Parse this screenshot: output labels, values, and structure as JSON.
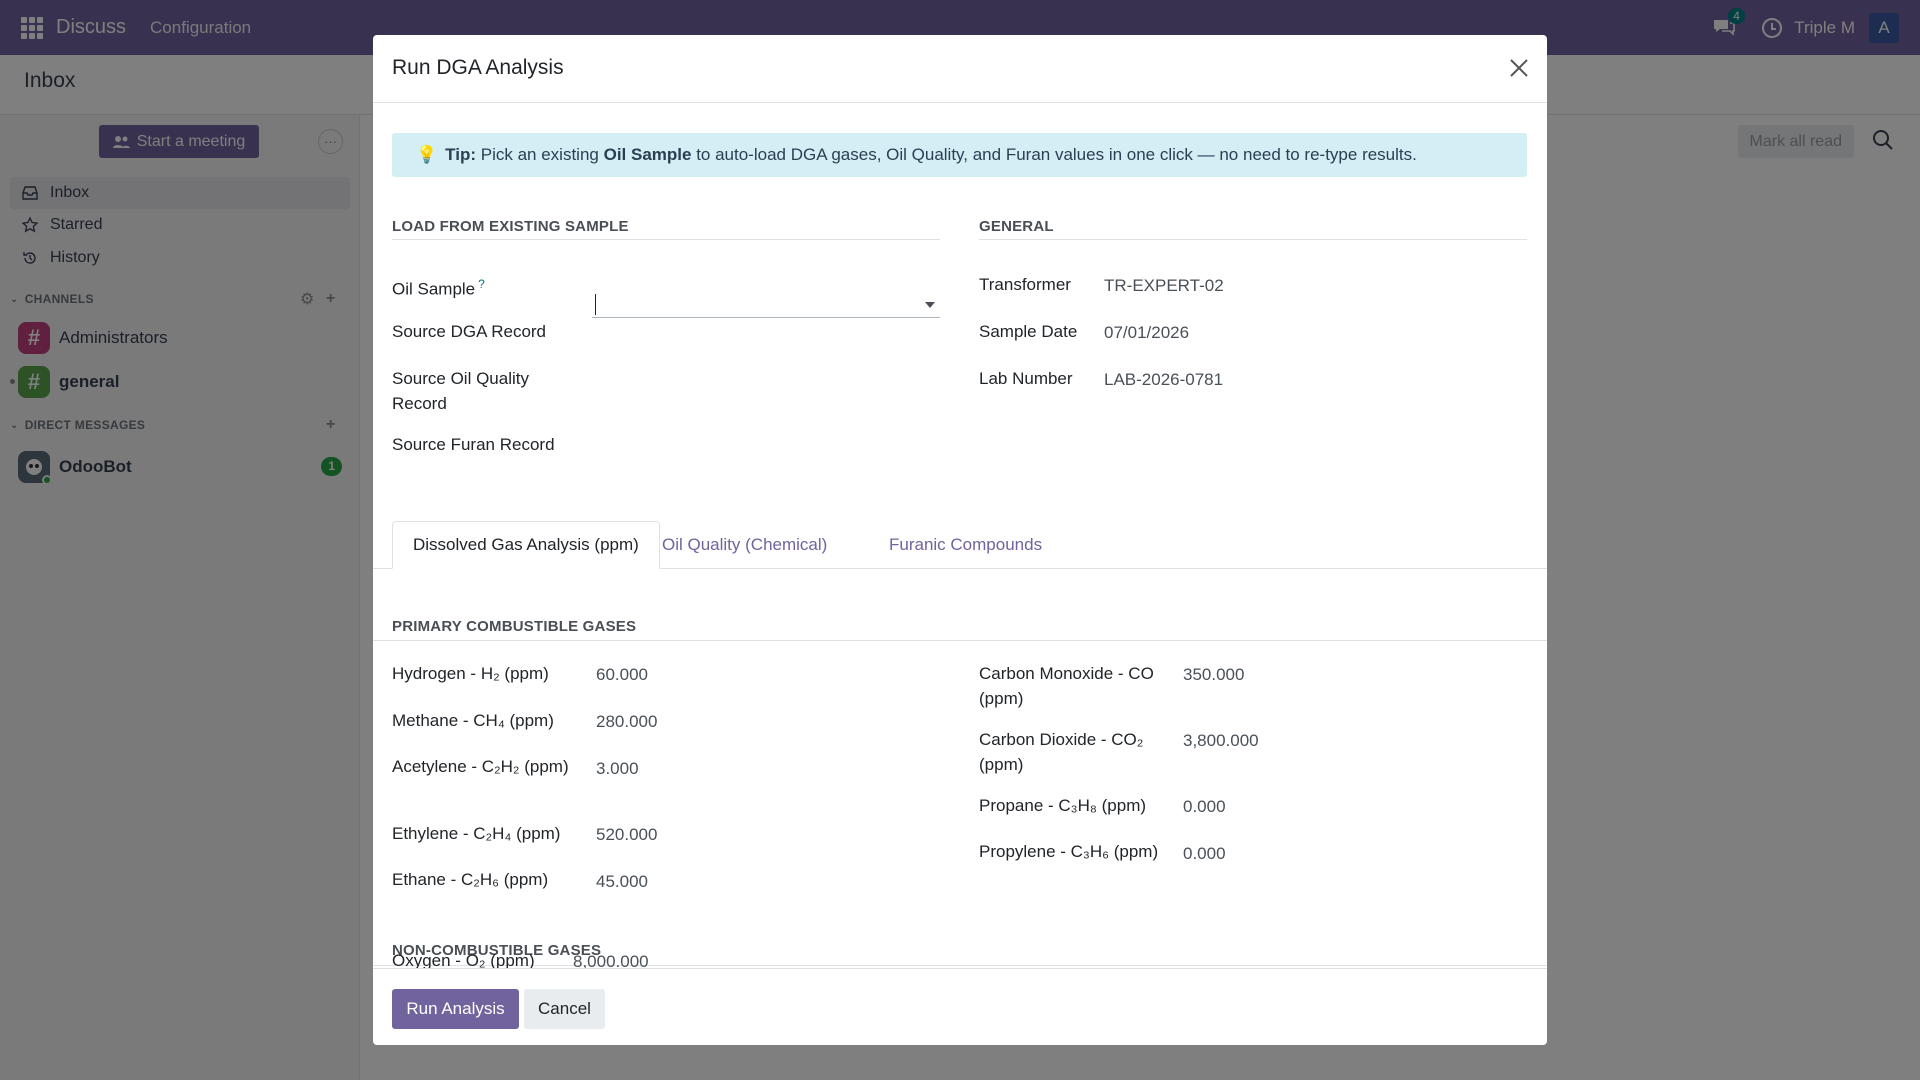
{
  "navbar": {
    "brand": "Discuss",
    "menu_configuration": "Configuration",
    "chat_count": "4",
    "company": "Triple M",
    "avatar_letter": "A"
  },
  "control_panel": {
    "title": "Inbox"
  },
  "sidebar": {
    "start_meeting": "Start a meeting",
    "more": "···",
    "items": [
      {
        "label": "Inbox"
      },
      {
        "label": "Starred"
      },
      {
        "label": "History"
      }
    ],
    "channels_heading": "CHANNELS",
    "channels": [
      {
        "name": "Administrators",
        "color": "#c2417a"
      },
      {
        "name": "general",
        "color": "#5aa54a"
      }
    ],
    "dm_heading": "DIRECT MESSAGES",
    "dms": [
      {
        "name": "OdooBot",
        "unread": "1"
      }
    ]
  },
  "main": {
    "mark_all_read": "Mark all read"
  },
  "modal": {
    "title": "Run DGA Analysis",
    "tip": {
      "prefix": "Tip:",
      "text1": " Pick an existing ",
      "bold": "Oil Sample",
      "text2": " to auto-load DGA gases, Oil Quality, and Furan values in one click — no need to re-type results."
    },
    "load_section": {
      "title": "LOAD FROM EXISTING SAMPLE",
      "oil_sample_label": "Oil Sample",
      "oil_sample_help": "?",
      "oil_sample_value": "",
      "source_dga": "Source DGA Record",
      "source_oil_quality": "Source Oil Quality Record",
      "source_furan": "Source Furan Record"
    },
    "general_section": {
      "title": "GENERAL",
      "transformer_label": "Transformer",
      "transformer_value": "TR-EXPERT-02",
      "sample_date_label": "Sample Date",
      "sample_date_value": "07/01/2026",
      "lab_number_label": "Lab Number",
      "lab_number_value": "LAB-2026-0781"
    },
    "tabs": [
      {
        "label": "Dissolved Gas Analysis (ppm)"
      },
      {
        "label": "Oil Quality (Chemical)"
      },
      {
        "label": "Furanic Compounds"
      }
    ],
    "primary": {
      "title": "PRIMARY COMBUSTIBLE GASES",
      "left": [
        {
          "label": "Hydrogen - H₂ (ppm)",
          "value": "60.000"
        },
        {
          "label": "Methane - CH₄ (ppm)",
          "value": "280.000"
        },
        {
          "label": "Acetylene - C₂H₂ (ppm)",
          "value": "3.000"
        },
        {
          "label": "Ethylene - C₂H₄ (ppm)",
          "value": "520.000"
        },
        {
          "label": "Ethane - C₂H₆ (ppm)",
          "value": "45.000"
        }
      ],
      "right": [
        {
          "label": "Carbon Monoxide - CO (ppm)",
          "value": "350.000"
        },
        {
          "label": "Carbon Dioxide - CO₂ (ppm)",
          "value": "3,800.000"
        },
        {
          "label": "Propane - C₃H₈ (ppm)",
          "value": "0.000"
        },
        {
          "label": "Propylene - C₃H₆ (ppm)",
          "value": "0.000"
        }
      ]
    },
    "noncombustible": {
      "title": "NON-COMBUSTIBLE GASES",
      "oxygen_label": "Oxygen - O₂ (ppm)",
      "oxygen_value": "8,000.000"
    },
    "footer": {
      "run": "Run Analysis",
      "cancel": "Cancel"
    }
  }
}
